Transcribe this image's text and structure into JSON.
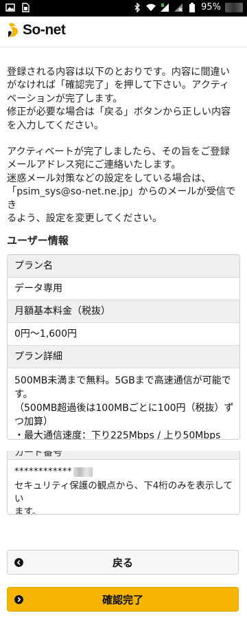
{
  "statusbar": {
    "battery": "95%",
    "icons": [
      "image-icon",
      "sim-icon",
      "bluetooth-icon",
      "wifi-icon",
      "signal-icon",
      "no-sim-icon",
      "battery-icon"
    ]
  },
  "header": {
    "logo_text": "So-net",
    "brand_color": "#f4b400"
  },
  "intro": {
    "para1": [
      "登録される内容は以下のとおりです。内容に間違い",
      "がなければ「確認完了」を押して下さい。アクティ",
      "ベーションが完了します。",
      "修正が必要な場合は「戻る」ボタンから正しい内容",
      "を入力してください。"
    ],
    "para2": [
      "アクティベートが完了しましたら、その旨をご登録",
      "メールアドレス宛にご連絡いたします。",
      "迷惑メール対策などの設定をしている場合は、",
      "「psim_sys@so-net.ne.jp」からのメールが受信でき",
      "るよう、設定を変更してください。"
    ]
  },
  "user_info": {
    "title": "ユーザー情報",
    "plan_label": "プラン名",
    "plan_value": "データ専用",
    "fee_label": "月額基本料金（税抜）",
    "fee_value": "0円～1,600円",
    "detail_label": "プラン詳細",
    "detail_lines": [
      "500MB未満まで無料。5GBまで高速通信が可能で",
      "す。",
      "（500MB超過後は100MBごとに100円（税抜）ず",
      "つ加算）",
      "・最大通信速度：下り225Mbps / 上り50Mbps"
    ],
    "card_label": "カード番号",
    "card_masked": "************",
    "card_note": [
      "セキュリティ保護の観点から、下4桁のみを表示してい",
      "ます。"
    ]
  },
  "buttons": {
    "back": "戻る",
    "confirm": "確認完了"
  }
}
